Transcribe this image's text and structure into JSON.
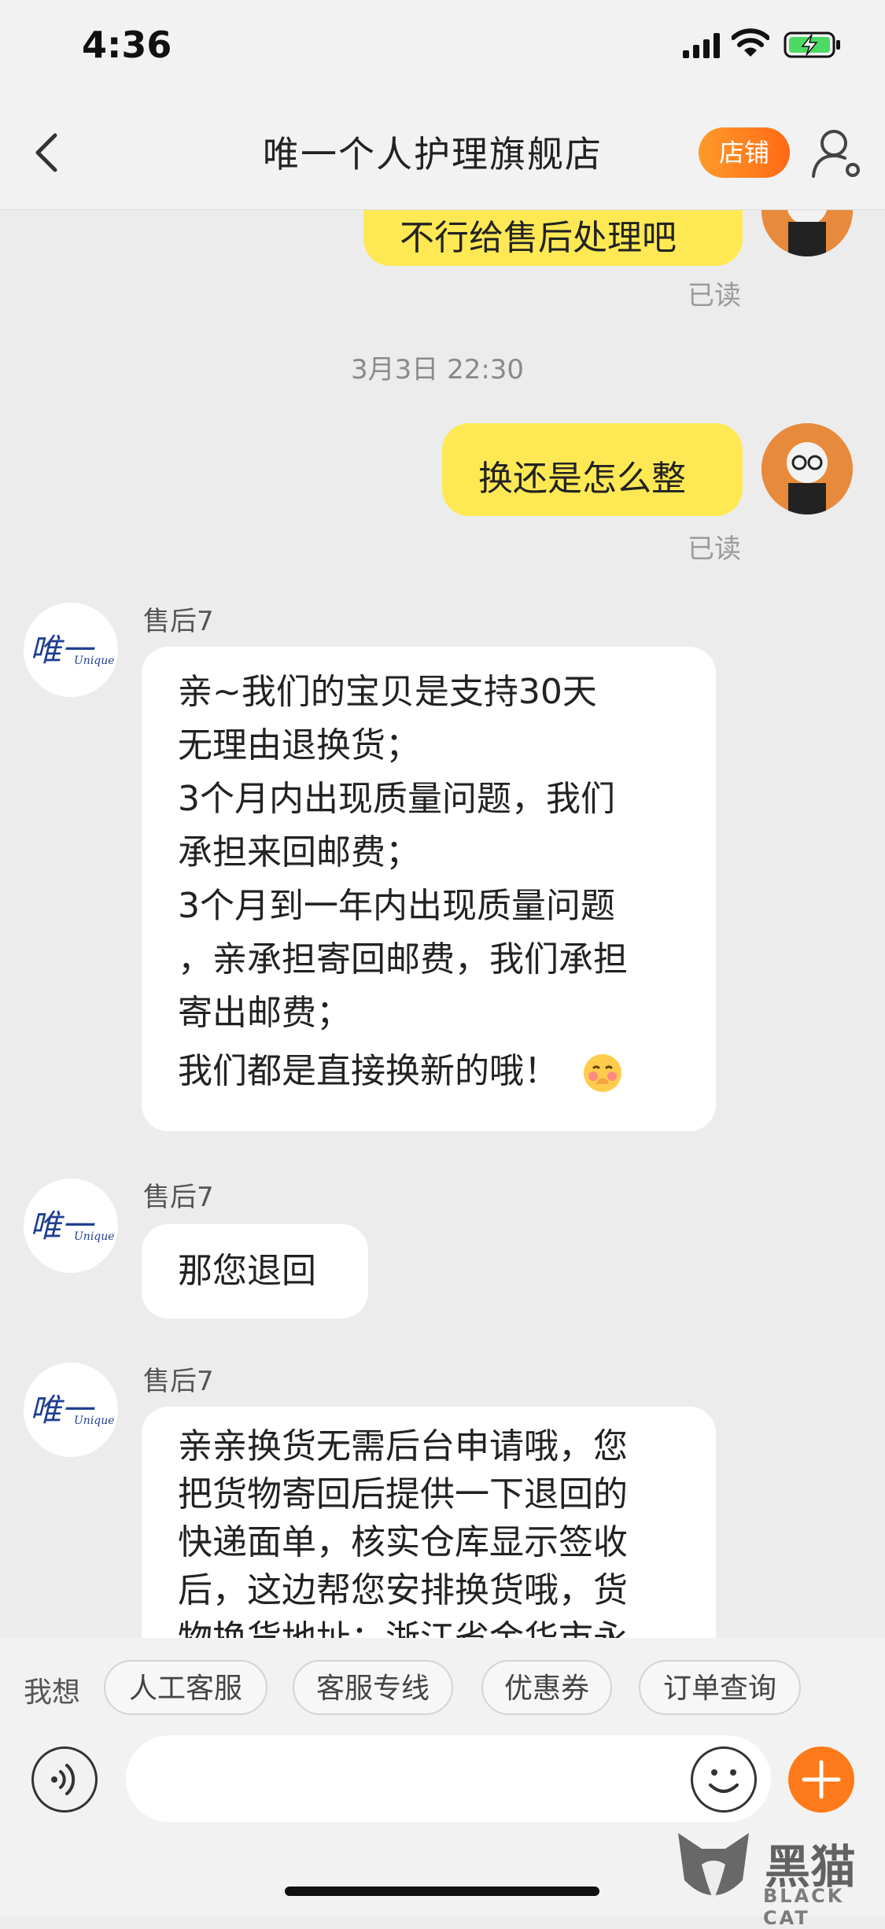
{
  "status_bar": {
    "time": "4:36"
  },
  "nav": {
    "title": "唯一个人护理旗舰店",
    "shop_button": "店铺"
  },
  "chat": {
    "prev_message": "不行给售后处理吧",
    "prev_read": "已读",
    "timestamp": "3月3日 22:30",
    "my_message": "换还是怎么整",
    "my_read": "已读",
    "shop_logo_text": "唯一",
    "shop_logo_sub": "Unique",
    "messages": [
      {
        "sender": "售后7",
        "lines": [
          "亲~我们的宝贝是支持30天",
          "无理由退换货；",
          "3个月内出现质量问题，我们",
          "承担来回邮费；",
          "3个月到一年内出现质量问题",
          "，亲承担寄回邮费，我们承担",
          "寄出邮费；",
          "我们都是直接换新的哦！"
        ]
      },
      {
        "sender": "售后7",
        "lines": [
          "那您退回"
        ]
      },
      {
        "sender": "售后7",
        "lines": [
          "亲亲换货无需后台申请哦，您",
          "把货物寄回后提供一下退回的",
          "快递面单，核实仓库显示签收",
          "后，这边帮您安排换货哦，货",
          "物换货地址：浙江省金华市永"
        ]
      }
    ]
  },
  "quick_replies": {
    "label": "我想",
    "chips": [
      "人工客服",
      "客服专线",
      "优惠券",
      "订单查询"
    ]
  },
  "input": {
    "placeholder": ""
  },
  "watermark": {
    "text": "黑猫",
    "sub": "BLACK CAT"
  },
  "colors": {
    "accent": "#ff7a1a",
    "my_bubble": "#fee955",
    "background": "#ececec"
  }
}
